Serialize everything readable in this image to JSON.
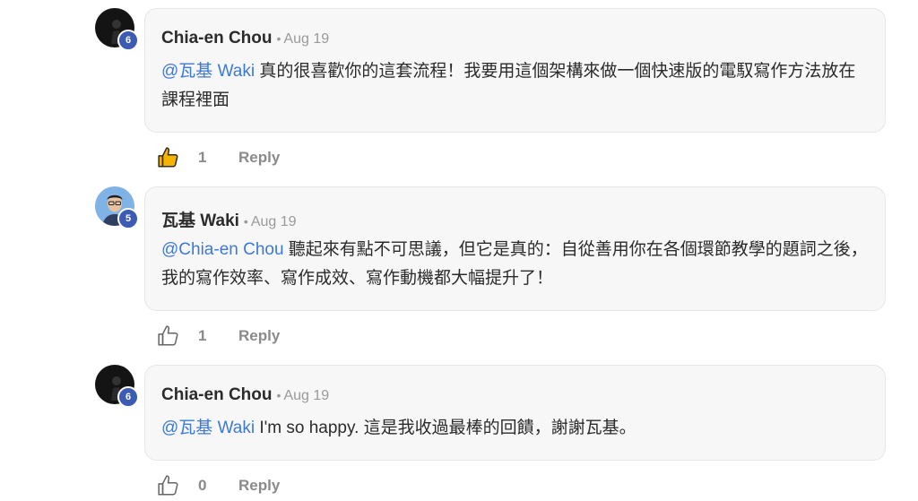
{
  "colors": {
    "mention": "#3d79d8",
    "badge": "#3b5bb5",
    "bubble": "#f7f7f7",
    "meta": "#9a9a9a"
  },
  "reply_label": "Reply",
  "comments": [
    {
      "author": "Chia-en Chou",
      "date": "Aug 19",
      "level": "6",
      "mention": "@瓦基 Waki",
      "text": " 真的很喜歡你的這套流程！我要用這個架構來做一個快速版的電馭寫作方法放在課程裡面",
      "likes": "1",
      "liked": true
    },
    {
      "author": "瓦基 Waki",
      "date": "Aug 19",
      "level": "5",
      "mention": "@Chia-en Chou",
      "text": " 聽起來有點不可思議，但它是真的：自從善用你在各個環節教學的題詞之後，我的寫作效率、寫作成效、寫作動機都大幅提升了！",
      "likes": "1",
      "liked": false
    },
    {
      "author": "Chia-en Chou",
      "date": "Aug 19",
      "level": "6",
      "mention": "@瓦基 Waki",
      "text": " I'm so happy. 這是我收過最棒的回饋，謝謝瓦基。",
      "likes": "0",
      "liked": false
    }
  ]
}
